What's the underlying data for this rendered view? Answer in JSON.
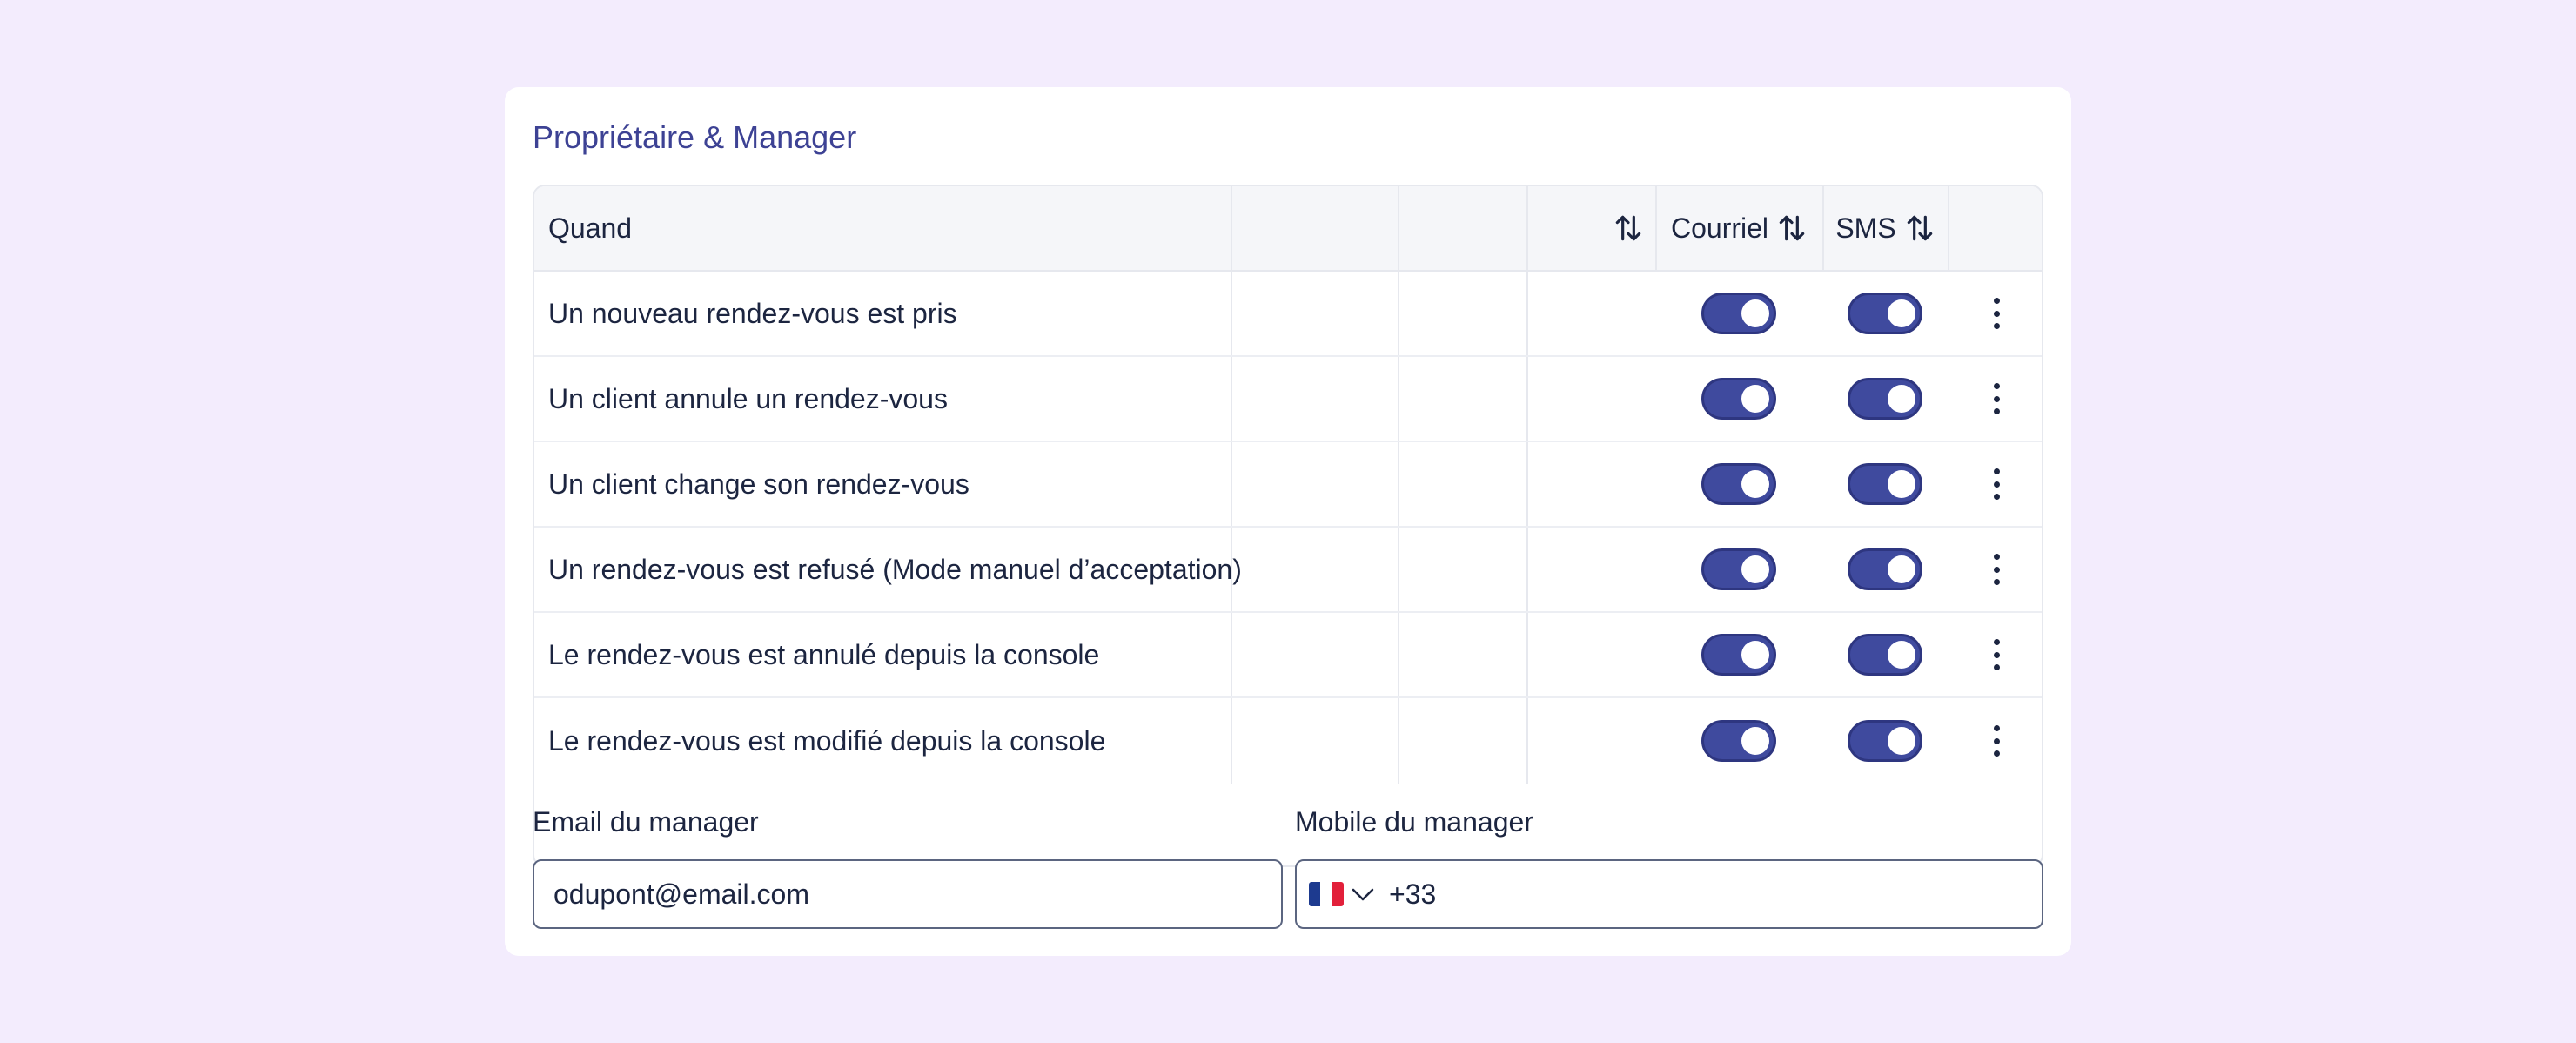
{
  "section": {
    "title": "Propriétaire & Manager"
  },
  "table": {
    "headers": {
      "when": "Quand",
      "email": "Courriel",
      "sms": "SMS"
    },
    "rows": [
      {
        "label": "Un nouveau rendez-vous est pris",
        "email_on": true,
        "sms_on": true
      },
      {
        "label": "Un client annule un rendez-vous",
        "email_on": true,
        "sms_on": true
      },
      {
        "label": "Un client change son rendez-vous",
        "email_on": true,
        "sms_on": true
      },
      {
        "label": "Un rendez-vous est refusé (Mode manuel d’acceptation)",
        "email_on": true,
        "sms_on": true
      },
      {
        "label": "Le rendez-vous est annulé depuis la console",
        "email_on": true,
        "sms_on": true
      },
      {
        "label": "Le rendez-vous est modifié depuis la console",
        "email_on": true,
        "sms_on": true
      }
    ]
  },
  "manager": {
    "email_label": "Email du manager",
    "email_value": "odupont@email.com",
    "mobile_label": "Mobile du manager",
    "mobile_country": "FR",
    "mobile_value": "+33"
  },
  "colors": {
    "accent": "#3f4a9e",
    "title": "#3d4294",
    "background": "#f3ecfd"
  },
  "icons": {
    "sort": "sort-arrows-icon",
    "menu": "more-vertical-icon",
    "flag": "france-flag-icon",
    "dropdown": "chevron-down-icon"
  }
}
